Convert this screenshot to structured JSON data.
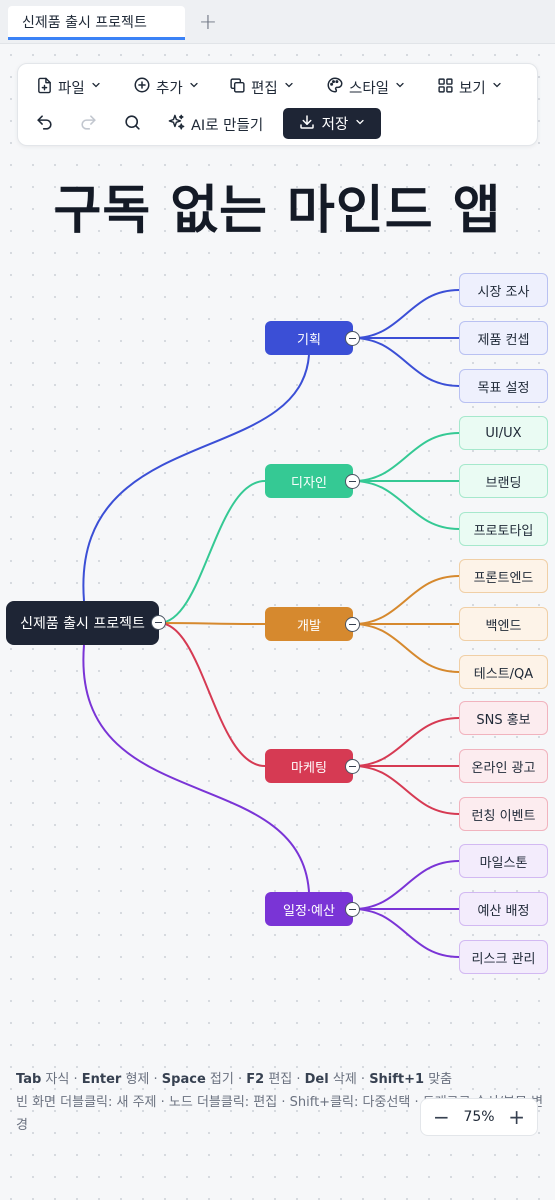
{
  "tab": {
    "title": "신제품 출시 프로젝트",
    "add": "+"
  },
  "toolbar": {
    "file": "파일",
    "add": "추가",
    "edit": "편집",
    "style": "스타일",
    "view": "보기",
    "ai": "AI로 만들기",
    "save": "저장"
  },
  "title": "구독 없는 마인드 앱",
  "mindmap": {
    "root": "신제품 출시 프로젝트",
    "branches": [
      {
        "label": "기획",
        "color": "#3b4fd6",
        "leafBg": "#eef0fd",
        "leafBorder": "#b9c1f2",
        "leaves": [
          "시장 조사",
          "제품 컨셉",
          "목표 설정"
        ]
      },
      {
        "label": "디자인",
        "color": "#35c994",
        "leafBg": "#eafbf3",
        "leafBorder": "#a6e8cc",
        "leaves": [
          "UI/UX",
          "브랜딩",
          "프로토타입"
        ]
      },
      {
        "label": "개발",
        "color": "#d6892e",
        "leafBg": "#fdf3e8",
        "leafBorder": "#f0cfa6",
        "leaves": [
          "프론트엔드",
          "백엔드",
          "테스트/QA"
        ]
      },
      {
        "label": "마케팅",
        "color": "#d63a53",
        "leafBg": "#fcecef",
        "leafBorder": "#f1b3be",
        "leaves": [
          "SNS 홍보",
          "온라인 광고",
          "런칭 이벤트"
        ]
      },
      {
        "label": "일정·예산",
        "color": "#7a34d6",
        "leafBg": "#f3ecfc",
        "leafBorder": "#d2b9f2",
        "leaves": [
          "마일스톤",
          "예산 배정",
          "리스크 관리"
        ]
      }
    ]
  },
  "help": {
    "k1": "Tab",
    "d1": "자식",
    "k2": "Enter",
    "d2": "형제",
    "k3": "Space",
    "d3": "접기",
    "k4": "F2",
    "d4": "편집",
    "k5": "Del",
    "d5": "삭제",
    "k6": "Shift+1",
    "d6": "맞춤",
    "line2": "빈 화면 더블클릭: 새 주제 · 노드 더블클릭: 편집 · Shift+클릭: 다중선택 · 드래그로 순서/부모 변경"
  },
  "zoom": {
    "minus": "−",
    "level": "75%",
    "plus": "+"
  }
}
